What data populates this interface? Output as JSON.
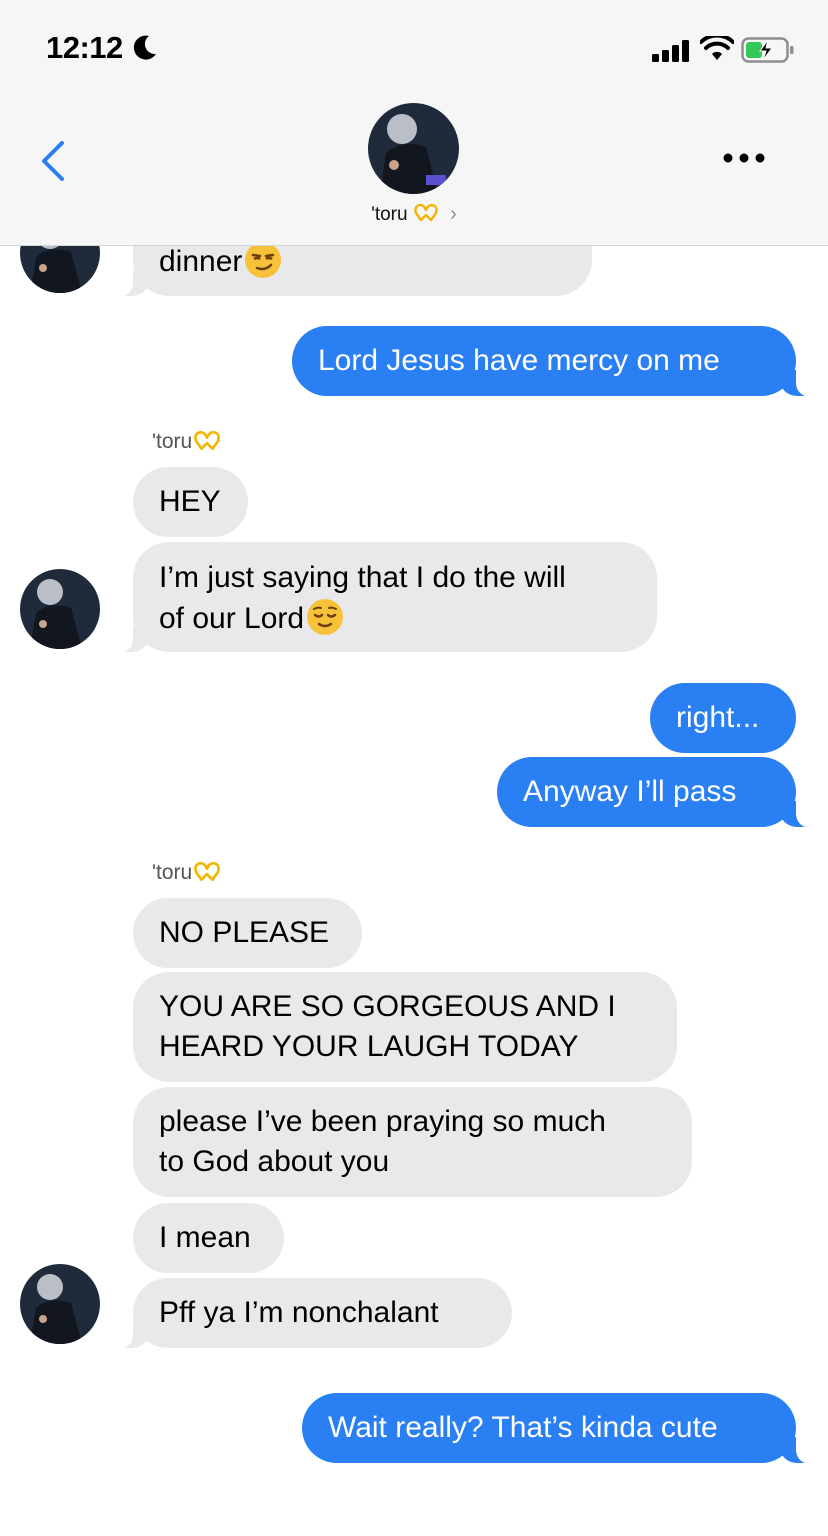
{
  "status_bar": {
    "time": "12:12"
  },
  "header": {
    "contact_name": "'toru",
    "chevron": "›"
  },
  "messages": [
    {
      "direction": "in",
      "text": "dinner"
    },
    {
      "direction": "out",
      "text": "Lord Jesus have mercy on me"
    },
    {
      "direction": "in",
      "sender": "'toru",
      "text": "HEY"
    },
    {
      "direction": "in",
      "line1": "I’m just saying that I do the will",
      "line2": "of our Lord"
    },
    {
      "direction": "out",
      "text": "right..."
    },
    {
      "direction": "out",
      "text": "Anyway I’ll pass"
    },
    {
      "direction": "in",
      "sender": "'toru",
      "text": "NO PLEASE"
    },
    {
      "direction": "in",
      "line1": "YOU ARE SO GORGEOUS AND I",
      "line2": "HEARD YOUR LAUGH TODAY"
    },
    {
      "direction": "in",
      "line1": "please I’ve been praying so much",
      "line2": "to God about you"
    },
    {
      "direction": "in",
      "text": "I mean"
    },
    {
      "direction": "in",
      "text": "Pff ya I’m nonchalant"
    },
    {
      "direction": "out",
      "text": "Wait really? That’s kinda cute"
    }
  ],
  "colors": {
    "outgoing": "#2a7ff3",
    "incoming": "#e9e9eb",
    "accent": "#2a7ff3"
  },
  "icons": [
    "moon-icon",
    "signal-icon",
    "wifi-icon",
    "battery-charging-icon",
    "back-chevron-icon",
    "more-icon",
    "heart-hands-emoji",
    "smirk-emoji",
    "relieved-emoji"
  ]
}
